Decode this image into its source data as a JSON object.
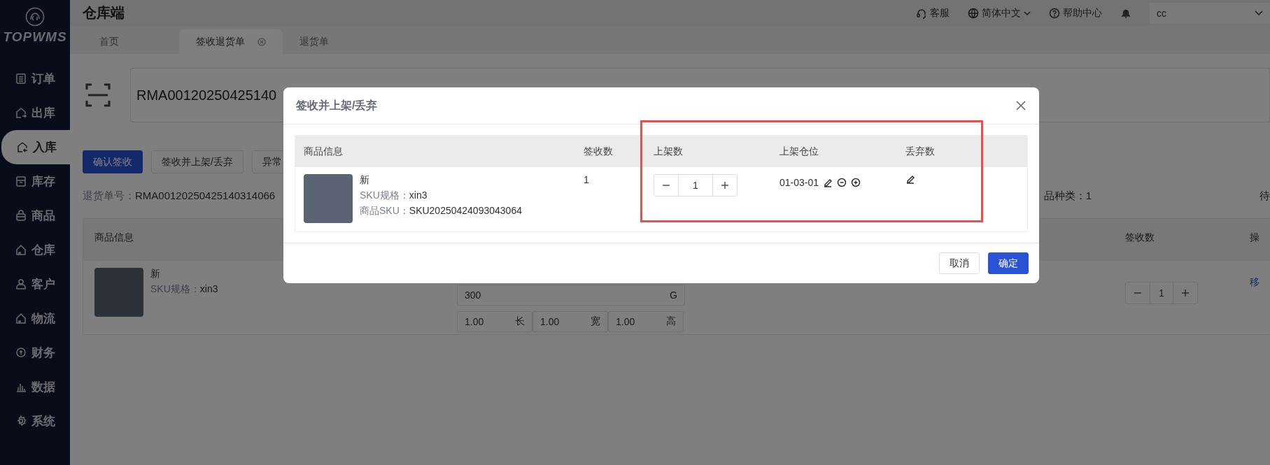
{
  "sidebar": {
    "logo": "TOPWMS",
    "items": [
      {
        "label": "订单",
        "kind": "list",
        "selected": false
      },
      {
        "label": "出库",
        "kind": "out",
        "selected": false
      },
      {
        "label": "入库",
        "kind": "in",
        "selected": true
      },
      {
        "label": "库存",
        "kind": "stock",
        "selected": false
      },
      {
        "label": "商品",
        "kind": "bag",
        "selected": false
      },
      {
        "label": "仓库",
        "kind": "house",
        "selected": false
      },
      {
        "label": "客户",
        "kind": "user",
        "selected": false
      },
      {
        "label": "物流",
        "kind": "house",
        "selected": false
      },
      {
        "label": "财务",
        "kind": "coin",
        "selected": false
      },
      {
        "label": "数据",
        "kind": "chart",
        "selected": false
      },
      {
        "label": "系统",
        "kind": "gear",
        "selected": false
      }
    ]
  },
  "header": {
    "title": "仓库端",
    "links": [
      {
        "kind": "service",
        "label": "客服"
      },
      {
        "kind": "language",
        "label": "简体中文"
      },
      {
        "kind": "help",
        "label": "帮助中心"
      }
    ],
    "user_select": {
      "value": "cc"
    }
  },
  "tabs": [
    {
      "label": "首页",
      "selected": false,
      "closable": false
    },
    {
      "label": "签收退货单",
      "selected": true,
      "closable": true
    },
    {
      "label": "退货单",
      "selected": false,
      "closable": false
    }
  ],
  "scan_input": {
    "value": "RMA00120250425140"
  },
  "actions": [
    {
      "label": "确认签收",
      "kind": "primary"
    },
    {
      "label": "签收并上架/丢弃",
      "kind": "default"
    },
    {
      "label": "异常",
      "kind": "default"
    }
  ],
  "order_no": {
    "label": "退货单号：",
    "value": "RMA00120250425140314066"
  },
  "summary": [
    "品种类：1",
    "待"
  ],
  "table": {
    "columns": [
      {
        "label": "商品信息"
      },
      {
        "label": "签收数"
      },
      {
        "label": "操"
      }
    ],
    "rows": [
      {
        "name": "新",
        "spec_label": "SKU规格：",
        "spec": "xin3",
        "weight": "300",
        "weight_unit": "G",
        "dims": [
          {
            "value": "1.00",
            "unit": "长"
          },
          {
            "value": "1.00",
            "unit": "宽"
          },
          {
            "value": "1.00",
            "unit": "高"
          }
        ],
        "quantity": "1",
        "action": "移"
      }
    ]
  },
  "dialog": {
    "title": "签收并上架/丢弃",
    "highlight": true,
    "columns": [
      {
        "label": "商品信息"
      },
      {
        "label": "签收数"
      },
      {
        "label": "上架数"
      },
      {
        "label": "上架仓位"
      },
      {
        "label": "丢弃数"
      }
    ],
    "rows": [
      {
        "name": "新",
        "spec_label": "SKU规格：",
        "spec": "xin3",
        "sku_label": "商品SKU：",
        "sku": "SKU20250424093043064",
        "received": "1",
        "shelve_qty": "1",
        "location": "01-03-01"
      }
    ],
    "buttons": [
      {
        "label": "取消",
        "kind": "default"
      },
      {
        "label": "确定",
        "kind": "primary"
      }
    ]
  }
}
